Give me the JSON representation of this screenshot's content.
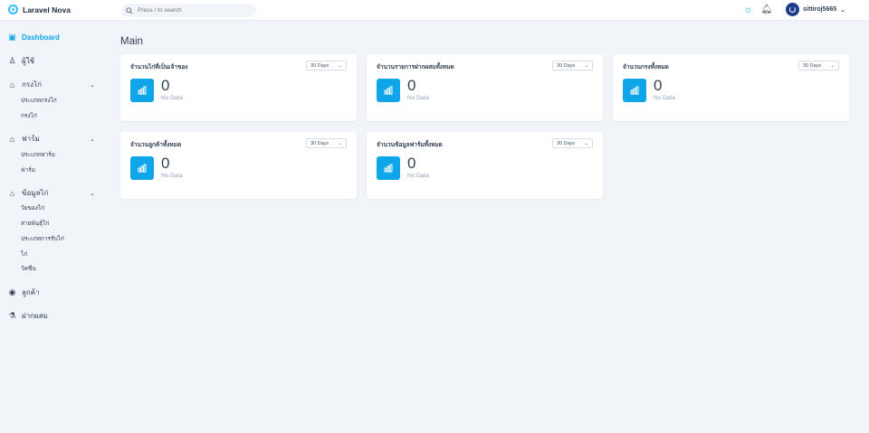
{
  "header": {
    "app_name": "Laravel Nova",
    "search_placeholder": "Press / to search",
    "username": "sittiroj5665"
  },
  "sidebar": {
    "dashboard": "Dashboard",
    "users": "ผู้ใช้",
    "cages": {
      "label": "กรงไก่",
      "items": [
        "ประเภทกรงไก่",
        "กรงไก่"
      ]
    },
    "farms": {
      "label": "ฟาร์ม",
      "items": [
        "ประเภทฟาร์ม",
        "ฟาร์ม"
      ]
    },
    "chicken_data": {
      "label": "ข้อมูลไก่",
      "items": [
        "วัยของไก่",
        "สายพันธุ์ไก่",
        "ประเภทการรับไก่",
        "ไก่",
        "วัคซีน"
      ]
    },
    "customers": "ลูกค้า",
    "breeding": "ฝากผสม"
  },
  "main": {
    "title": "Main",
    "cards": [
      {
        "title": "จำนวนไก่ที่เป็นเจ้าของ",
        "range": "30 Days",
        "value": "0",
        "note": "No Data"
      },
      {
        "title": "จำนวนรายการฝากผสมทั้งหมด",
        "range": "30 Days",
        "value": "0",
        "note": "No Data"
      },
      {
        "title": "จำนวนกรงทั้งหมด",
        "range": "30 Days",
        "value": "0",
        "note": "No Data"
      },
      {
        "title": "จำนวนลูกค้าทั้งหมด",
        "range": "30 Days",
        "value": "0",
        "note": "No Data"
      },
      {
        "title": "จำนวนข้อมูลฟาร์มทั้งหมด",
        "range": "30 Days",
        "value": "0",
        "note": "No Data"
      }
    ]
  },
  "colors": {
    "accent": "#0ea5e9",
    "background": "#f1f4f9"
  }
}
